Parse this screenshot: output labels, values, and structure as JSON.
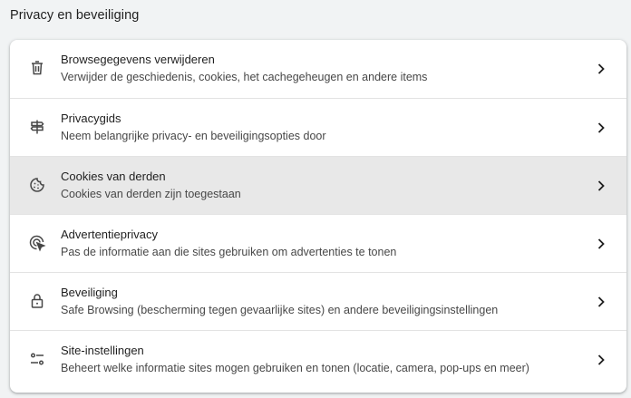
{
  "section": {
    "title": "Privacy en beveiliging"
  },
  "items": [
    {
      "title": "Browsegegevens verwijderen",
      "subtitle": "Verwijder de geschiedenis, cookies, het cachegeheugen en andere items",
      "icon": "trash-icon"
    },
    {
      "title": "Privacygids",
      "subtitle": "Neem belangrijke privacy- en beveiligingsopties door",
      "icon": "signpost-icon"
    },
    {
      "title": "Cookies van derden",
      "subtitle": "Cookies van derden zijn toegestaan",
      "icon": "cookie-icon"
    },
    {
      "title": "Advertentieprivacy",
      "subtitle": "Pas de informatie aan die sites gebruiken om advertenties te tonen",
      "icon": "ad-target-icon"
    },
    {
      "title": "Beveiliging",
      "subtitle": "Safe Browsing (bescherming tegen gevaarlijke sites) en andere beveiligingsinstellingen",
      "icon": "lock-icon"
    },
    {
      "title": "Site-instellingen",
      "subtitle": "Beheert welke informatie sites mogen gebruiken en tonen (locatie, camera, pop-ups en meer)",
      "icon": "sliders-icon"
    }
  ],
  "colors": {
    "page_background": "#f1f3f4",
    "card_background": "#ffffff",
    "highlight_row": "#e8e8e8",
    "text_primary": "#1f1f1f",
    "text_secondary": "#474747",
    "icon": "#474747"
  }
}
